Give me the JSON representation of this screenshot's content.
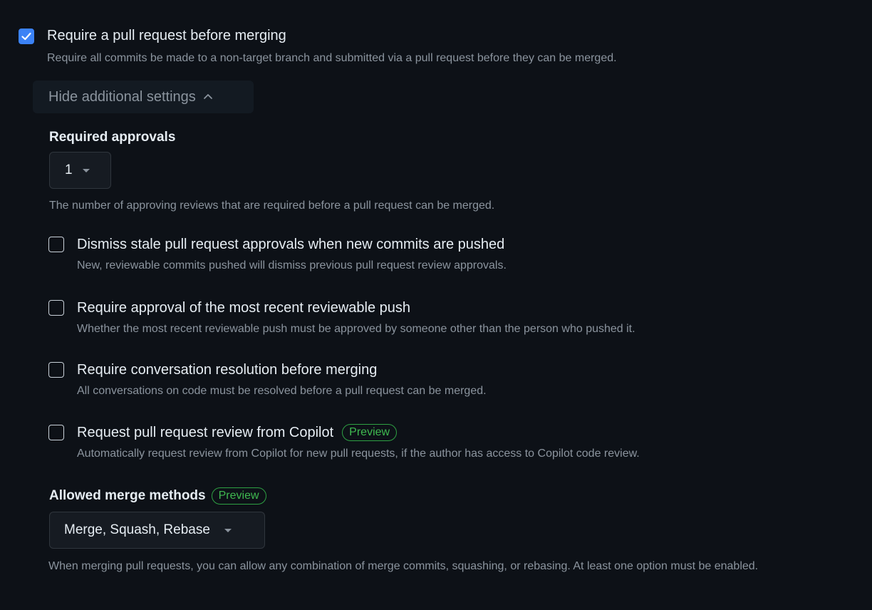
{
  "main_rule": {
    "checked": true,
    "title": "Require a pull request before merging",
    "description": "Require all commits be made to a non-target branch and submitted via a pull request before they can be merged."
  },
  "toggle": {
    "label": "Hide additional settings"
  },
  "required_approvals": {
    "title": "Required approvals",
    "selected": "1",
    "help": "The number of approving reviews that are required before a pull request can be merged."
  },
  "options": [
    {
      "checked": false,
      "title": "Dismiss stale pull request approvals when new commits are pushed",
      "description": "New, reviewable commits pushed will dismiss previous pull request review approvals."
    },
    {
      "checked": false,
      "title": "Require approval of the most recent reviewable push",
      "description": "Whether the most recent reviewable push must be approved by someone other than the person who pushed it."
    },
    {
      "checked": false,
      "title": "Require conversation resolution before merging",
      "description": "All conversations on code must be resolved before a pull request can be merged."
    },
    {
      "checked": false,
      "title": "Request pull request review from Copilot",
      "badge": "Preview",
      "description": "Automatically request review from Copilot for new pull requests, if the author has access to Copilot code review."
    }
  ],
  "merge_methods": {
    "title": "Allowed merge methods",
    "badge": "Preview",
    "selected": "Merge, Squash, Rebase",
    "help": "When merging pull requests, you can allow any combination of merge commits, squashing, or rebasing. At least one option must be enabled."
  },
  "icons": {
    "checkmark": "check-icon",
    "toggle_chevron": "chevron-up-icon",
    "select_caret": "triangle-down-icon"
  },
  "colors": {
    "background": "#0d1117",
    "accent": "#3b82f6",
    "preview_green": "#3fb950",
    "muted_text": "#8b949e"
  }
}
